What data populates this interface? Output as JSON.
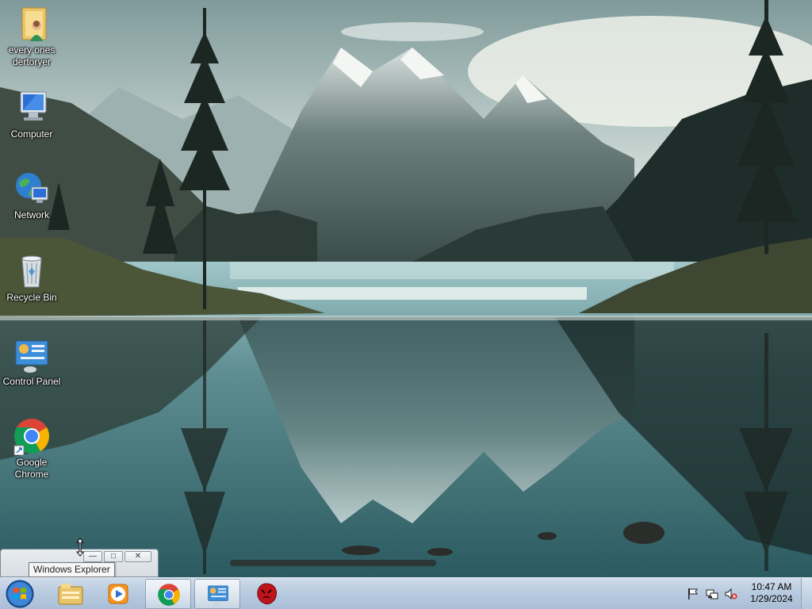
{
  "desktop": {
    "icons": [
      {
        "label": "every ones dertoryer",
        "icon": "user-folder-icon"
      },
      {
        "label": "Computer",
        "icon": "computer-icon"
      },
      {
        "label": "Network",
        "icon": "network-icon"
      },
      {
        "label": "Recycle Bin",
        "icon": "recycle-bin-icon"
      },
      {
        "label": "Control Panel",
        "icon": "control-panel-icon"
      },
      {
        "label": "Google Chrome",
        "icon": "chrome-icon"
      }
    ]
  },
  "tooltip": {
    "text": "Windows Explorer"
  },
  "mini_window": {
    "buttons": [
      "minimize-icon",
      "maximize-icon",
      "close-icon"
    ]
  },
  "taskbar": {
    "start": "windows-logo-icon",
    "pinned": [
      "file-explorer-icon",
      "media-player-icon",
      "chrome-icon",
      "control-panel-icon",
      "red-app-icon"
    ],
    "tray": [
      "action-center-flag-icon",
      "network-status-icon",
      "volume-muted-icon"
    ],
    "clock": {
      "time": "10:47 AM",
      "date": "1/29/2024"
    }
  },
  "colors": {
    "taskbar": "#b9cbe0",
    "chrome_red": "#db4437",
    "chrome_green": "#0f9d58",
    "chrome_yellow": "#f4b400",
    "chrome_blue": "#4285f4"
  }
}
